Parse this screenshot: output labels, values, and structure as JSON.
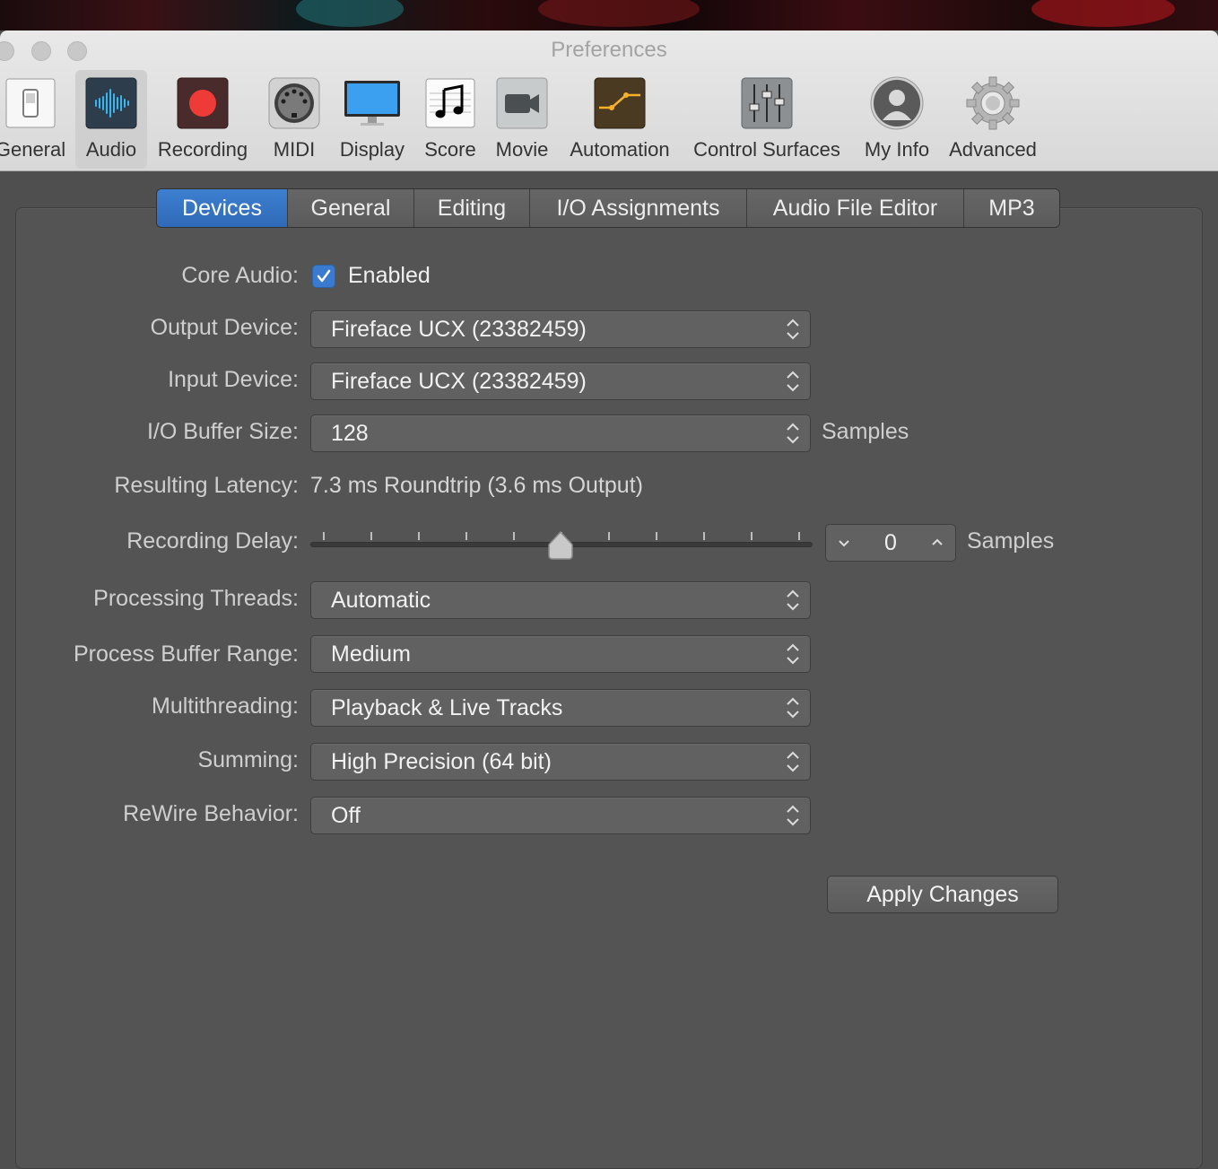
{
  "window": {
    "title": "Preferences"
  },
  "toolbar": {
    "items": [
      {
        "label": "General",
        "icon": "switch-icon",
        "active": false
      },
      {
        "label": "Audio",
        "icon": "waveform-icon",
        "active": true
      },
      {
        "label": "Recording",
        "icon": "record-icon",
        "active": false
      },
      {
        "label": "MIDI",
        "icon": "midi-connector-icon",
        "active": false
      },
      {
        "label": "Display",
        "icon": "monitor-icon",
        "active": false
      },
      {
        "label": "Score",
        "icon": "music-note-icon",
        "active": false
      },
      {
        "label": "Movie",
        "icon": "camera-icon",
        "active": false
      },
      {
        "label": "Automation",
        "icon": "automation-curve-icon",
        "active": false
      },
      {
        "label": "Control Surfaces",
        "icon": "faders-icon",
        "active": false
      },
      {
        "label": "My Info",
        "icon": "user-icon",
        "active": false
      },
      {
        "label": "Advanced",
        "icon": "gear-icon",
        "active": false
      }
    ]
  },
  "tabs": [
    {
      "label": "Devices",
      "active": true
    },
    {
      "label": "General",
      "active": false
    },
    {
      "label": "Editing",
      "active": false
    },
    {
      "label": "I/O Assignments",
      "active": false
    },
    {
      "label": "Audio File Editor",
      "active": false
    },
    {
      "label": "MP3",
      "active": false
    }
  ],
  "form": {
    "core_audio": {
      "label": "Core Audio:",
      "checkbox_label": "Enabled",
      "checked": true
    },
    "output_device": {
      "label": "Output Device:",
      "value": "Fireface UCX (23382459)"
    },
    "input_device": {
      "label": "Input Device:",
      "value": "Fireface UCX (23382459)"
    },
    "buffer_size": {
      "label": "I/O Buffer Size:",
      "value": "128",
      "unit": "Samples"
    },
    "latency": {
      "label": "Resulting Latency:",
      "value": "7.3 ms Roundtrip (3.6 ms Output)"
    },
    "recording_delay": {
      "label": "Recording Delay:",
      "value": "0",
      "unit": "Samples",
      "slider_fraction": 0.5
    },
    "processing_threads": {
      "label": "Processing Threads:",
      "value": "Automatic"
    },
    "process_buffer_range": {
      "label": "Process Buffer Range:",
      "value": "Medium"
    },
    "multithreading": {
      "label": "Multithreading:",
      "value": "Playback & Live Tracks"
    },
    "summing": {
      "label": "Summing:",
      "value": "High Precision (64 bit)"
    },
    "rewire": {
      "label": "ReWire Behavior:",
      "value": "Off"
    }
  },
  "apply_button": {
    "label": "Apply Changes"
  },
  "colors": {
    "accent": "#3a7bd0",
    "record": "#e8403d",
    "panel": "#545454"
  }
}
